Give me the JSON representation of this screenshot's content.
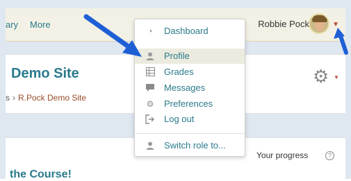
{
  "navbar": {
    "links": [
      "ary",
      "More"
    ],
    "user_name": "Robbie Pock"
  },
  "header": {
    "site_title": "Demo Site",
    "breadcrumb_prefix": "s",
    "breadcrumb_link": "R.Pock Demo Site"
  },
  "content": {
    "progress_label": "Your progress",
    "help_glyph": "?",
    "course_heading": "the Course!"
  },
  "user_menu": {
    "items": [
      {
        "label": "Dashboard",
        "icon": "dashboard-icon"
      },
      {
        "label": "Profile",
        "icon": "user-icon"
      },
      {
        "label": "Grades",
        "icon": "grades-table-icon"
      },
      {
        "label": "Messages",
        "icon": "chat-bubble-icon"
      },
      {
        "label": "Preferences",
        "icon": "wrench-icon"
      },
      {
        "label": "Log out",
        "icon": "sign-out-icon"
      },
      {
        "label": "Switch role to...",
        "icon": "user-icon"
      }
    ],
    "active_item": "Profile"
  },
  "colors": {
    "link": "#2a7a8c",
    "navbar_bg": "#f3f1e5",
    "highlight_bg": "#ecebdf",
    "arrow": "#1e5fd6"
  }
}
